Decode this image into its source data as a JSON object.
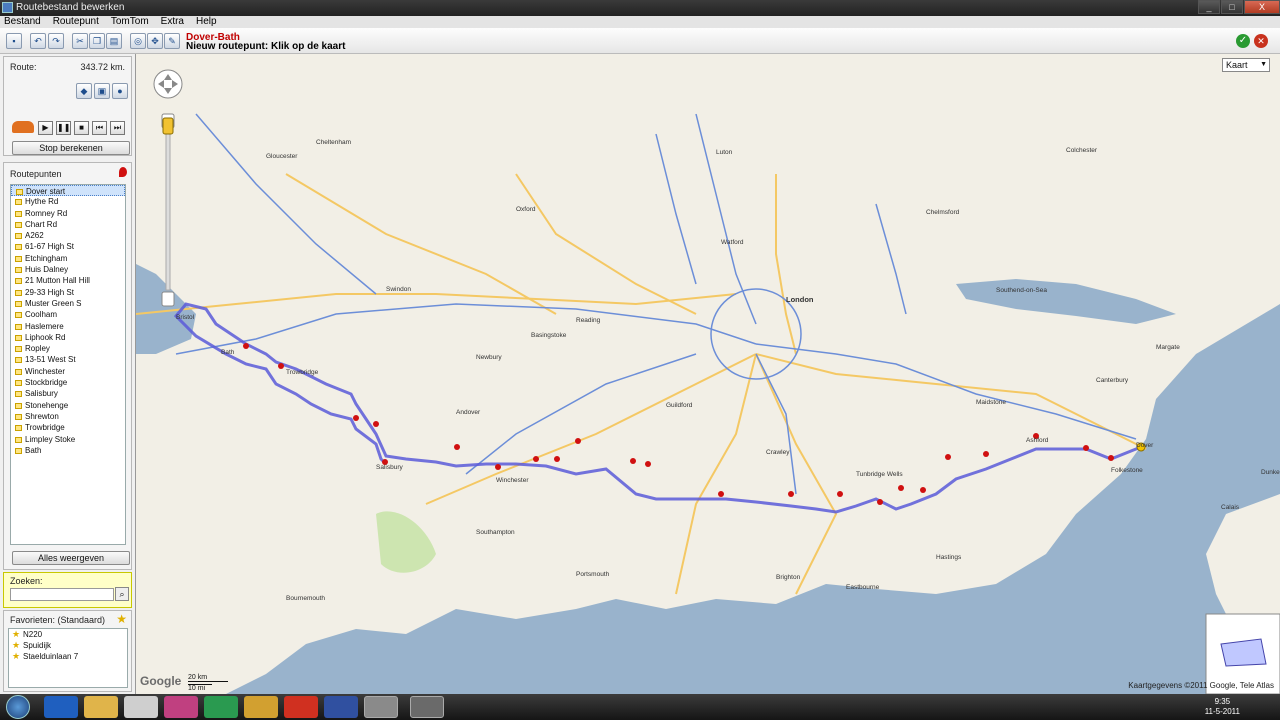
{
  "window": {
    "title": "Routebestand bewerken",
    "controls": [
      "_",
      "□",
      "X"
    ]
  },
  "menu": [
    "Bestand",
    "Routepunt",
    "TomTom",
    "Extra",
    "Help"
  ],
  "toolbar": {
    "route_name": "Dover-Bath",
    "hint": "Nieuw routepunt: Klik op de kaart"
  },
  "sidebar": {
    "route_label": "Route:",
    "route_distance": "343.72 km.",
    "stop_button": "Stop berekenen",
    "waypoints_label": "Routepunten",
    "waypoints": [
      "Dover start",
      "Hythe Rd",
      "Romney Rd",
      "Chart Rd",
      "A262",
      "61-67 High St",
      "Etchingham",
      "Huis Dalney",
      "21 Mutton Hall Hill",
      "29-33 High St",
      "Muster Green S",
      "Coolham",
      "Haslemere",
      "Liphook Rd",
      "Ropley",
      "13-51 West St",
      "Winchester",
      "Stockbridge",
      "Salisbury",
      "Stonehenge",
      "Shrewton",
      "Trowbridge",
      "Limpley Stoke",
      "Bath"
    ],
    "show_all_button": "Alles weergeven",
    "search_label": "Zoeken:",
    "search_value": "",
    "favorites_label": "Favorieten: (Standaard)",
    "favorites": [
      "N220",
      "Spuidijk",
      "Staelduinlaan 7"
    ]
  },
  "map": {
    "type_select": "Kaart",
    "copyright": "Kaartgegevens ©2011 Google, Tele Atlas",
    "logo": "Google",
    "scale_km": "20 km",
    "scale_mi": "10 mi",
    "cities": [
      {
        "name": "London",
        "big": true
      },
      {
        "name": "Brighton",
        "big": false
      },
      {
        "name": "Southampton",
        "big": false
      },
      {
        "name": "Portsmouth",
        "big": false
      },
      {
        "name": "Bristol",
        "big": false
      },
      {
        "name": "Swindon",
        "big": false
      },
      {
        "name": "Reading",
        "big": false
      },
      {
        "name": "Oxford",
        "big": false
      },
      {
        "name": "Salisbury",
        "big": false
      },
      {
        "name": "Winchester",
        "big": false
      },
      {
        "name": "Basingstoke",
        "big": false
      },
      {
        "name": "Guildford",
        "big": false
      },
      {
        "name": "Crawley",
        "big": false
      },
      {
        "name": "Maidstone",
        "big": false
      },
      {
        "name": "Ashford",
        "big": false
      },
      {
        "name": "Folkestone",
        "big": false
      },
      {
        "name": "Dover",
        "big": false
      },
      {
        "name": "Canterbury",
        "big": false
      },
      {
        "name": "Hastings",
        "big": false
      },
      {
        "name": "Eastbourne",
        "big": false
      },
      {
        "name": "Bournemouth",
        "big": false
      },
      {
        "name": "Chelmsford",
        "big": false
      },
      {
        "name": "Colchester",
        "big": false
      },
      {
        "name": "Cheltenham",
        "big": false
      },
      {
        "name": "Gloucester",
        "big": false
      },
      {
        "name": "Luton",
        "big": false
      },
      {
        "name": "Watford",
        "big": false
      },
      {
        "name": "Margate",
        "big": false
      },
      {
        "name": "Southend-on-Sea",
        "big": false
      },
      {
        "name": "Bath",
        "big": false
      },
      {
        "name": "Trowbridge",
        "big": false
      },
      {
        "name": "Tunbridge Wells",
        "big": false
      },
      {
        "name": "Andover",
        "big": false
      },
      {
        "name": "Newbury",
        "big": false
      },
      {
        "name": "Calais",
        "big": false
      },
      {
        "name": "Dunkerque",
        "big": false
      }
    ]
  },
  "taskbar": {
    "time": "9:35",
    "date": "11-5-2011"
  }
}
